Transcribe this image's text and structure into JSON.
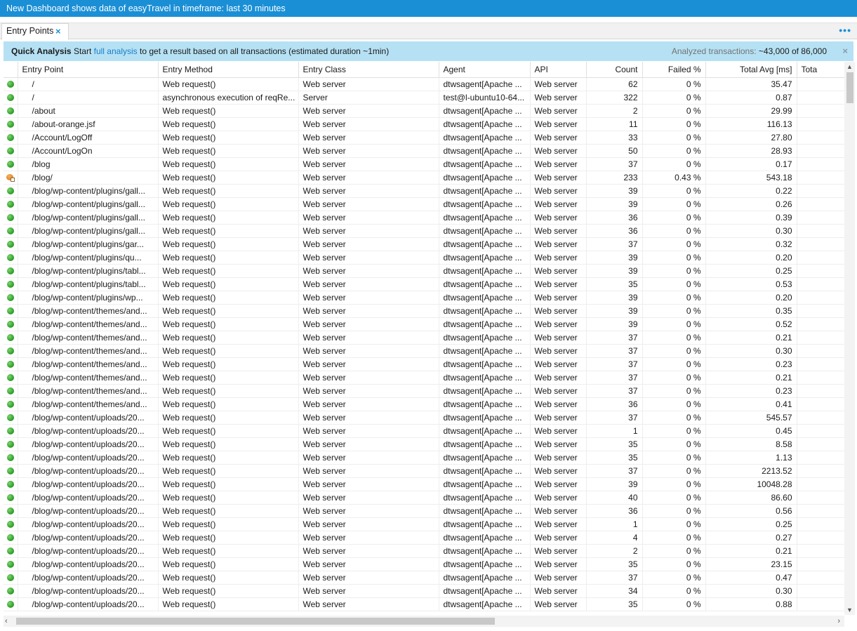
{
  "titlebar": {
    "text": "New Dashboard shows data of easyTravel in timeframe: last 30 minutes"
  },
  "tabbar": {
    "tab_label": "Entry Points",
    "close_glyph": "×",
    "more_glyph": "•••"
  },
  "infobar": {
    "title": "Quick Analysis",
    "start": "Start",
    "link": "full analysis",
    "rest": "to get a result based on all transactions (estimated duration ~1min)",
    "analyzed_label": "Analyzed transactions:",
    "analyzed_value": "~43,000 of 86,000",
    "close_glyph": "×"
  },
  "columns": [
    "Entry Point",
    "Entry Method",
    "Entry Class",
    "Agent",
    "API",
    "Count",
    "Failed %",
    "Total Avg [ms]",
    "Tota"
  ],
  "rows": [
    {
      "status": "ok",
      "ep": "/",
      "method": "Web request()",
      "cls": "Web server",
      "agent": "dtwsagent[Apache ...",
      "api": "Web server",
      "count": "62",
      "failed": "0 %",
      "avg": "35.47"
    },
    {
      "status": "ok",
      "ep": "/",
      "method": "asynchronous execution of reqRe...",
      "cls": "Server",
      "agent": "test@l-ubuntu10-64...",
      "api": "Web server",
      "count": "322",
      "failed": "0 %",
      "avg": "0.87"
    },
    {
      "status": "ok",
      "ep": "/about",
      "method": "Web request()",
      "cls": "Web server",
      "agent": "dtwsagent[Apache ...",
      "api": "Web server",
      "count": "2",
      "failed": "0 %",
      "avg": "29.99"
    },
    {
      "status": "ok",
      "ep": "/about-orange.jsf",
      "method": "Web request()",
      "cls": "Web server",
      "agent": "dtwsagent[Apache ...",
      "api": "Web server",
      "count": "11",
      "failed": "0 %",
      "avg": "116.13"
    },
    {
      "status": "ok",
      "ep": "/Account/LogOff",
      "method": "Web request()",
      "cls": "Web server",
      "agent": "dtwsagent[Apache ...",
      "api": "Web server",
      "count": "33",
      "failed": "0 %",
      "avg": "27.80"
    },
    {
      "status": "ok",
      "ep": "/Account/LogOn",
      "method": "Web request()",
      "cls": "Web server",
      "agent": "dtwsagent[Apache ...",
      "api": "Web server",
      "count": "50",
      "failed": "0 %",
      "avg": "28.93"
    },
    {
      "status": "ok",
      "ep": "/blog",
      "method": "Web request()",
      "cls": "Web server",
      "agent": "dtwsagent[Apache ...",
      "api": "Web server",
      "count": "37",
      "failed": "0 %",
      "avg": "0.17"
    },
    {
      "status": "warn",
      "ep": "/blog/",
      "method": "Web request()",
      "cls": "Web server",
      "agent": "dtwsagent[Apache ...",
      "api": "Web server",
      "count": "233",
      "failed": "0.43 %",
      "avg": "543.18"
    },
    {
      "status": "ok",
      "ep": "/blog/wp-content/plugins/gall...",
      "method": "Web request()",
      "cls": "Web server",
      "agent": "dtwsagent[Apache ...",
      "api": "Web server",
      "count": "39",
      "failed": "0 %",
      "avg": "0.22"
    },
    {
      "status": "ok",
      "ep": "/blog/wp-content/plugins/gall...",
      "method": "Web request()",
      "cls": "Web server",
      "agent": "dtwsagent[Apache ...",
      "api": "Web server",
      "count": "39",
      "failed": "0 %",
      "avg": "0.26"
    },
    {
      "status": "ok",
      "ep": "/blog/wp-content/plugins/gall...",
      "method": "Web request()",
      "cls": "Web server",
      "agent": "dtwsagent[Apache ...",
      "api": "Web server",
      "count": "36",
      "failed": "0 %",
      "avg": "0.39"
    },
    {
      "status": "ok",
      "ep": "/blog/wp-content/plugins/gall...",
      "method": "Web request()",
      "cls": "Web server",
      "agent": "dtwsagent[Apache ...",
      "api": "Web server",
      "count": "36",
      "failed": "0 %",
      "avg": "0.30"
    },
    {
      "status": "ok",
      "ep": "/blog/wp-content/plugins/gar...",
      "method": "Web request()",
      "cls": "Web server",
      "agent": "dtwsagent[Apache ...",
      "api": "Web server",
      "count": "37",
      "failed": "0 %",
      "avg": "0.32"
    },
    {
      "status": "ok",
      "ep": "/blog/wp-content/plugins/qu...",
      "method": "Web request()",
      "cls": "Web server",
      "agent": "dtwsagent[Apache ...",
      "api": "Web server",
      "count": "39",
      "failed": "0 %",
      "avg": "0.20"
    },
    {
      "status": "ok",
      "ep": "/blog/wp-content/plugins/tabl...",
      "method": "Web request()",
      "cls": "Web server",
      "agent": "dtwsagent[Apache ...",
      "api": "Web server",
      "count": "39",
      "failed": "0 %",
      "avg": "0.25"
    },
    {
      "status": "ok",
      "ep": "/blog/wp-content/plugins/tabl...",
      "method": "Web request()",
      "cls": "Web server",
      "agent": "dtwsagent[Apache ...",
      "api": "Web server",
      "count": "35",
      "failed": "0 %",
      "avg": "0.53"
    },
    {
      "status": "ok",
      "ep": "/blog/wp-content/plugins/wp...",
      "method": "Web request()",
      "cls": "Web server",
      "agent": "dtwsagent[Apache ...",
      "api": "Web server",
      "count": "39",
      "failed": "0 %",
      "avg": "0.20"
    },
    {
      "status": "ok",
      "ep": "/blog/wp-content/themes/and...",
      "method": "Web request()",
      "cls": "Web server",
      "agent": "dtwsagent[Apache ...",
      "api": "Web server",
      "count": "39",
      "failed": "0 %",
      "avg": "0.35"
    },
    {
      "status": "ok",
      "ep": "/blog/wp-content/themes/and...",
      "method": "Web request()",
      "cls": "Web server",
      "agent": "dtwsagent[Apache ...",
      "api": "Web server",
      "count": "39",
      "failed": "0 %",
      "avg": "0.52"
    },
    {
      "status": "ok",
      "ep": "/blog/wp-content/themes/and...",
      "method": "Web request()",
      "cls": "Web server",
      "agent": "dtwsagent[Apache ...",
      "api": "Web server",
      "count": "37",
      "failed": "0 %",
      "avg": "0.21"
    },
    {
      "status": "ok",
      "ep": "/blog/wp-content/themes/and...",
      "method": "Web request()",
      "cls": "Web server",
      "agent": "dtwsagent[Apache ...",
      "api": "Web server",
      "count": "37",
      "failed": "0 %",
      "avg": "0.30"
    },
    {
      "status": "ok",
      "ep": "/blog/wp-content/themes/and...",
      "method": "Web request()",
      "cls": "Web server",
      "agent": "dtwsagent[Apache ...",
      "api": "Web server",
      "count": "37",
      "failed": "0 %",
      "avg": "0.23"
    },
    {
      "status": "ok",
      "ep": "/blog/wp-content/themes/and...",
      "method": "Web request()",
      "cls": "Web server",
      "agent": "dtwsagent[Apache ...",
      "api": "Web server",
      "count": "37",
      "failed": "0 %",
      "avg": "0.21"
    },
    {
      "status": "ok",
      "ep": "/blog/wp-content/themes/and...",
      "method": "Web request()",
      "cls": "Web server",
      "agent": "dtwsagent[Apache ...",
      "api": "Web server",
      "count": "37",
      "failed": "0 %",
      "avg": "0.23"
    },
    {
      "status": "ok",
      "ep": "/blog/wp-content/themes/and...",
      "method": "Web request()",
      "cls": "Web server",
      "agent": "dtwsagent[Apache ...",
      "api": "Web server",
      "count": "36",
      "failed": "0 %",
      "avg": "0.41"
    },
    {
      "status": "ok",
      "ep": "/blog/wp-content/uploads/20...",
      "method": "Web request()",
      "cls": "Web server",
      "agent": "dtwsagent[Apache ...",
      "api": "Web server",
      "count": "37",
      "failed": "0 %",
      "avg": "545.57"
    },
    {
      "status": "ok",
      "ep": "/blog/wp-content/uploads/20...",
      "method": "Web request()",
      "cls": "Web server",
      "agent": "dtwsagent[Apache ...",
      "api": "Web server",
      "count": "1",
      "failed": "0 %",
      "avg": "0.45"
    },
    {
      "status": "ok",
      "ep": "/blog/wp-content/uploads/20...",
      "method": "Web request()",
      "cls": "Web server",
      "agent": "dtwsagent[Apache ...",
      "api": "Web server",
      "count": "35",
      "failed": "0 %",
      "avg": "8.58"
    },
    {
      "status": "ok",
      "ep": "/blog/wp-content/uploads/20...",
      "method": "Web request()",
      "cls": "Web server",
      "agent": "dtwsagent[Apache ...",
      "api": "Web server",
      "count": "35",
      "failed": "0 %",
      "avg": "1.13"
    },
    {
      "status": "ok",
      "ep": "/blog/wp-content/uploads/20...",
      "method": "Web request()",
      "cls": "Web server",
      "agent": "dtwsagent[Apache ...",
      "api": "Web server",
      "count": "37",
      "failed": "0 %",
      "avg": "2213.52"
    },
    {
      "status": "ok",
      "ep": "/blog/wp-content/uploads/20...",
      "method": "Web request()",
      "cls": "Web server",
      "agent": "dtwsagent[Apache ...",
      "api": "Web server",
      "count": "39",
      "failed": "0 %",
      "avg": "10048.28"
    },
    {
      "status": "ok",
      "ep": "/blog/wp-content/uploads/20...",
      "method": "Web request()",
      "cls": "Web server",
      "agent": "dtwsagent[Apache ...",
      "api": "Web server",
      "count": "40",
      "failed": "0 %",
      "avg": "86.60"
    },
    {
      "status": "ok",
      "ep": "/blog/wp-content/uploads/20...",
      "method": "Web request()",
      "cls": "Web server",
      "agent": "dtwsagent[Apache ...",
      "api": "Web server",
      "count": "36",
      "failed": "0 %",
      "avg": "0.56"
    },
    {
      "status": "ok",
      "ep": "/blog/wp-content/uploads/20...",
      "method": "Web request()",
      "cls": "Web server",
      "agent": "dtwsagent[Apache ...",
      "api": "Web server",
      "count": "1",
      "failed": "0 %",
      "avg": "0.25"
    },
    {
      "status": "ok",
      "ep": "/blog/wp-content/uploads/20...",
      "method": "Web request()",
      "cls": "Web server",
      "agent": "dtwsagent[Apache ...",
      "api": "Web server",
      "count": "4",
      "failed": "0 %",
      "avg": "0.27"
    },
    {
      "status": "ok",
      "ep": "/blog/wp-content/uploads/20...",
      "method": "Web request()",
      "cls": "Web server",
      "agent": "dtwsagent[Apache ...",
      "api": "Web server",
      "count": "2",
      "failed": "0 %",
      "avg": "0.21"
    },
    {
      "status": "ok",
      "ep": "/blog/wp-content/uploads/20...",
      "method": "Web request()",
      "cls": "Web server",
      "agent": "dtwsagent[Apache ...",
      "api": "Web server",
      "count": "35",
      "failed": "0 %",
      "avg": "23.15"
    },
    {
      "status": "ok",
      "ep": "/blog/wp-content/uploads/20...",
      "method": "Web request()",
      "cls": "Web server",
      "agent": "dtwsagent[Apache ...",
      "api": "Web server",
      "count": "37",
      "failed": "0 %",
      "avg": "0.47"
    },
    {
      "status": "ok",
      "ep": "/blog/wp-content/uploads/20...",
      "method": "Web request()",
      "cls": "Web server",
      "agent": "dtwsagent[Apache ...",
      "api": "Web server",
      "count": "34",
      "failed": "0 %",
      "avg": "0.30"
    },
    {
      "status": "ok",
      "ep": "/blog/wp-content/uploads/20...",
      "method": "Web request()",
      "cls": "Web server",
      "agent": "dtwsagent[Apache ...",
      "api": "Web server",
      "count": "35",
      "failed": "0 %",
      "avg": "0.88"
    }
  ],
  "icons": {
    "ok": "green-status-icon",
    "warn": "warning-status-icon",
    "scroll_up": "▲",
    "scroll_down": "▼",
    "scroll_left": "‹",
    "scroll_right": "›"
  },
  "colors": {
    "title_bg": "#1a8fd6",
    "info_bg": "#b6e1f4",
    "link": "#1a7fc7"
  }
}
